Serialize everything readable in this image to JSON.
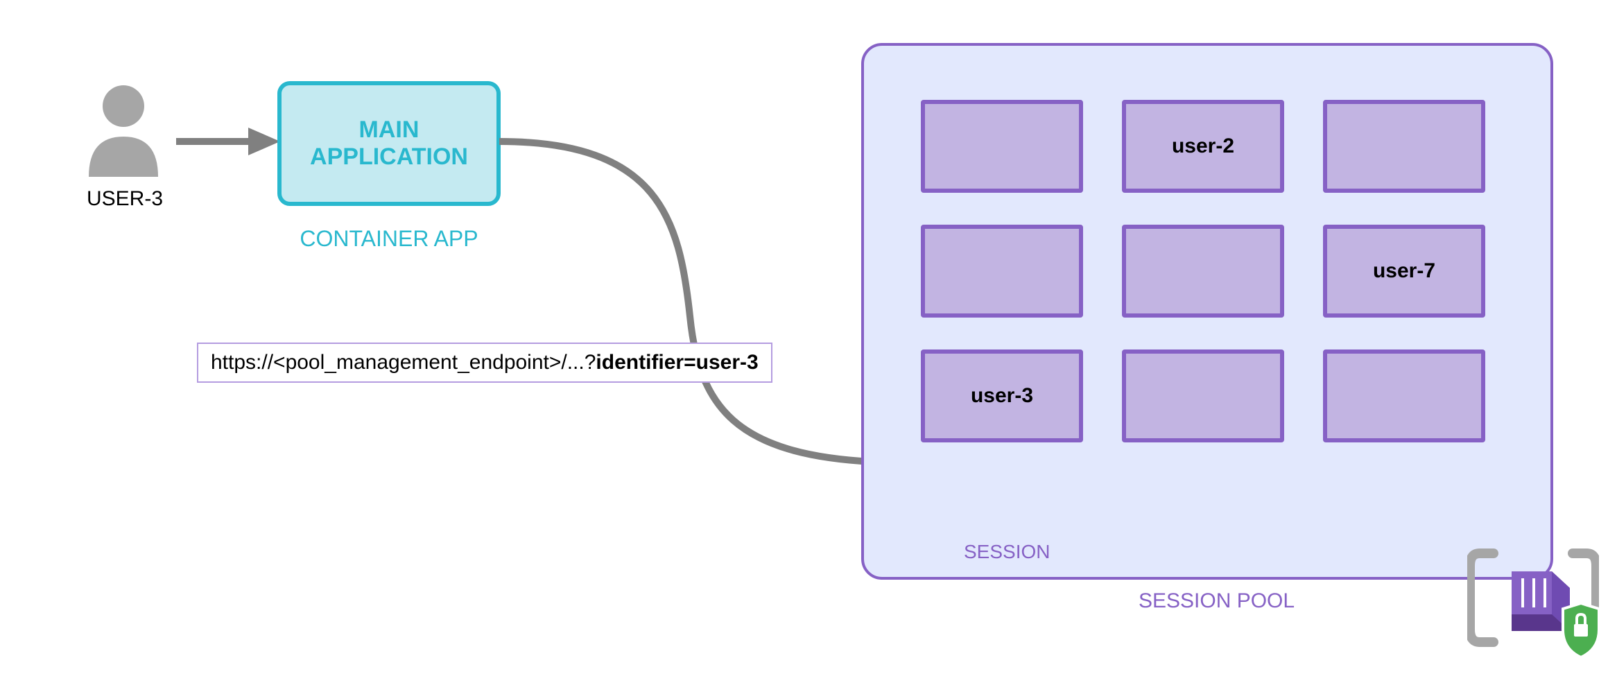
{
  "user": {
    "label": "USER-3"
  },
  "app": {
    "title_line1": "MAIN",
    "title_line2": "APPLICATION",
    "subtitle": "CONTAINER APP"
  },
  "url": {
    "prefix": "https://<pool_management_endpoint>/...?",
    "bold": "identifier=user-3"
  },
  "pool": {
    "label": "SESSION POOL",
    "session_label": "SESSION",
    "sessions": [
      {
        "label": ""
      },
      {
        "label": "user-2"
      },
      {
        "label": ""
      },
      {
        "label": ""
      },
      {
        "label": ""
      },
      {
        "label": "user-7"
      },
      {
        "label": "user-3"
      },
      {
        "label": ""
      },
      {
        "label": ""
      }
    ]
  }
}
